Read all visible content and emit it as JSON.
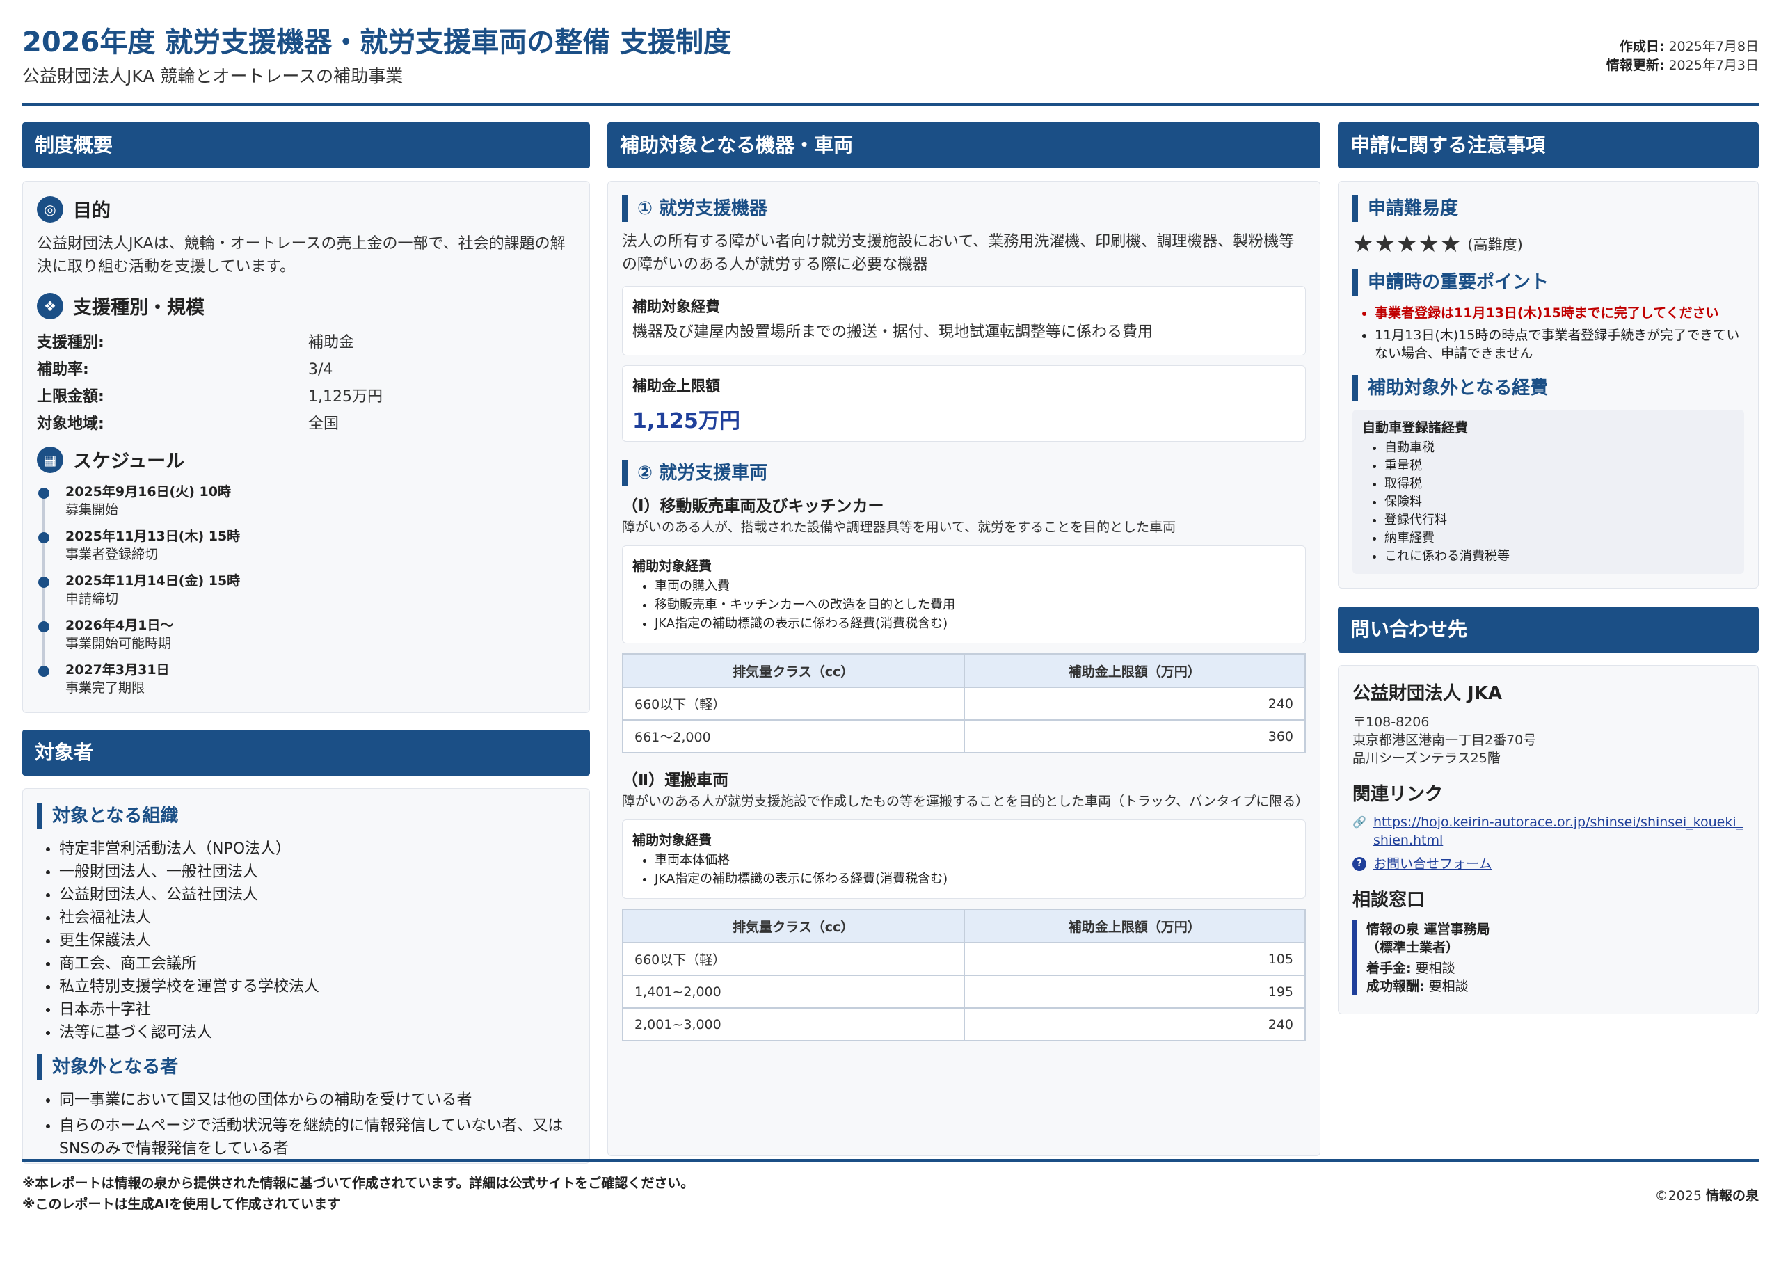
{
  "header": {
    "title": "2026年度 就労支援機器・就労支援車両の整備 支援制度",
    "subtitle": "公益財団法人JKA 競輪とオートレースの補助事業",
    "created_label": "作成日:",
    "created_value": "2025年7月8日",
    "updated_label": "情報更新:",
    "updated_value": "2025年7月3日"
  },
  "overview": {
    "heading": "制度概要",
    "purpose": {
      "icon": "target-icon",
      "title": "目的",
      "text": "公益財団法人JKAは、競輪・オートレースの売上金の一部で、社会的課題の解決に取り組む活動を支援しています。"
    },
    "scale": {
      "icon": "coins-icon",
      "title": "支援種別・規模",
      "rows": [
        {
          "k": "支援種別:",
          "v": "補助金"
        },
        {
          "k": "補助率:",
          "v": "3/4"
        },
        {
          "k": "上限金額:",
          "v": "1,125万円"
        },
        {
          "k": "対象地域:",
          "v": "全国"
        }
      ]
    },
    "schedule": {
      "icon": "calendar-icon",
      "title": "スケジュール",
      "items": [
        {
          "date": "2025年9月16日(火) 10時",
          "desc": "募集開始"
        },
        {
          "date": "2025年11月13日(木) 15時",
          "desc": "事業者登録締切"
        },
        {
          "date": "2025年11月14日(金) 15時",
          "desc": "申請締切"
        },
        {
          "date": "2026年4月1日〜",
          "desc": "事業開始可能時期"
        },
        {
          "date": "2027年3月31日",
          "desc": "事業完了期限"
        }
      ]
    }
  },
  "targets": {
    "heading": "対象者",
    "orgs_title": "対象となる組織",
    "orgs": [
      "特定非営利活動法人（NPO法人）",
      "一般財団法人、一般社団法人",
      "公益財団法人、公益社団法人",
      "社会福祉法人",
      "更生保護法人",
      "商工会、商工会議所",
      "私立特別支援学校を運営する学校法人",
      "日本赤十字社",
      "法等に基づく認可法人"
    ],
    "excluded_title": "対象外となる者",
    "excluded": [
      "同一事業において国又は他の団体からの補助を受けている者",
      "自らのホームページで活動状況等を継続的に情報発信していない者、又はSNSのみで情報発信をしている者"
    ]
  },
  "equipment": {
    "heading": "補助対象となる機器・車両",
    "machines": {
      "title": "① 就労支援機器",
      "desc": "法人の所有する障がい者向け就労支援施設において、業務用洗濯機、印刷機、調理機器、製粉機等の障がいのある人が就労する際に必要な機器",
      "cost_label": "補助対象経費",
      "cost_text": "機器及び建屋内設置場所までの搬送・据付、現地試運転調整等に係わる費用",
      "limit_label": "補助金上限額",
      "limit_value": "1,125万円"
    },
    "vehicles": {
      "title": "② 就労支援車両",
      "sub1": {
        "title": "（Ⅰ）移動販売車両及びキッチンカー",
        "desc": "障がいのある人が、搭載された設備や調理器具等を用いて、就労をすることを目的とした車両",
        "cost_label": "補助対象経費",
        "costs": [
          "車両の購入費",
          "移動販売車・キッチンカーへの改造を目的とした費用",
          "JKA指定の補助標識の表示に係わる経費(消費税含む)"
        ],
        "table": {
          "headers": [
            "排気量クラス（cc）",
            "補助金上限額（万円）"
          ],
          "rows": [
            [
              "660以下（軽）",
              "240"
            ],
            [
              "661〜2,000",
              "360"
            ]
          ]
        }
      },
      "sub2": {
        "title": "（Ⅱ）運搬車両",
        "desc": "障がいのある人が就労支援施設で作成したもの等を運搬することを目的とした車両（トラック、バンタイプに限る）",
        "cost_label": "補助対象経費",
        "costs": [
          "車両本体価格",
          "JKA指定の補助標識の表示に係わる経費(消費税含む)"
        ],
        "table": {
          "headers": [
            "排気量クラス（cc）",
            "補助金上限額（万円）"
          ],
          "rows": [
            [
              "660以下（軽）",
              "105"
            ],
            [
              "1,401~2,000",
              "195"
            ],
            [
              "2,001~3,000",
              "240"
            ]
          ]
        }
      }
    }
  },
  "notes": {
    "heading": "申請に関する注意事項",
    "difficulty_title": "申請難易度",
    "stars": "★★★★★",
    "difficulty_note": "(高難度)",
    "points_title": "申請時の重要ポイント",
    "points": [
      "事業者登録は11月13日(木)15時までに完了してください",
      "11月13日(木)15時の時点で事業者登録手続きが完了できていない場合、申請できません"
    ],
    "excluded_cost_title": "補助対象外となる経費",
    "excluded_cost_box_title": "自動車登録諸経費",
    "excluded_costs": [
      "自動車税",
      "重量税",
      "取得税",
      "保険料",
      "登録代行料",
      "納車経費",
      "これに係わる消費税等"
    ]
  },
  "contact": {
    "heading": "問い合わせ先",
    "org": "公益財団法人 JKA",
    "postal": "〒108-8206",
    "address1": "東京都港区港南一丁目2番70号",
    "address2": "品川シーズンテラス25階",
    "links_title": "関連リンク",
    "link1": "https://hojo.keirin-autorace.or.jp/shinsei/shinsei_koueki_shien.html",
    "link2": "お問い合せフォーム",
    "desk_title": "相談窓口",
    "desk_name": "情報の泉 運営事務局",
    "desk_sub": "（標準士業者）",
    "fee1_label": "着手金:",
    "fee1_value": "要相談",
    "fee2_label": "成功報酬:",
    "fee2_value": "要相談"
  },
  "footer": {
    "note1": "※本レポートは情報の泉から提供された情報に基づいて作成されています。詳細は公式サイトをご確認ください。",
    "note2": "※このレポートは生成AIを使用して作成されています",
    "copy_prefix": "©2025",
    "copy_name": "情報の泉"
  }
}
